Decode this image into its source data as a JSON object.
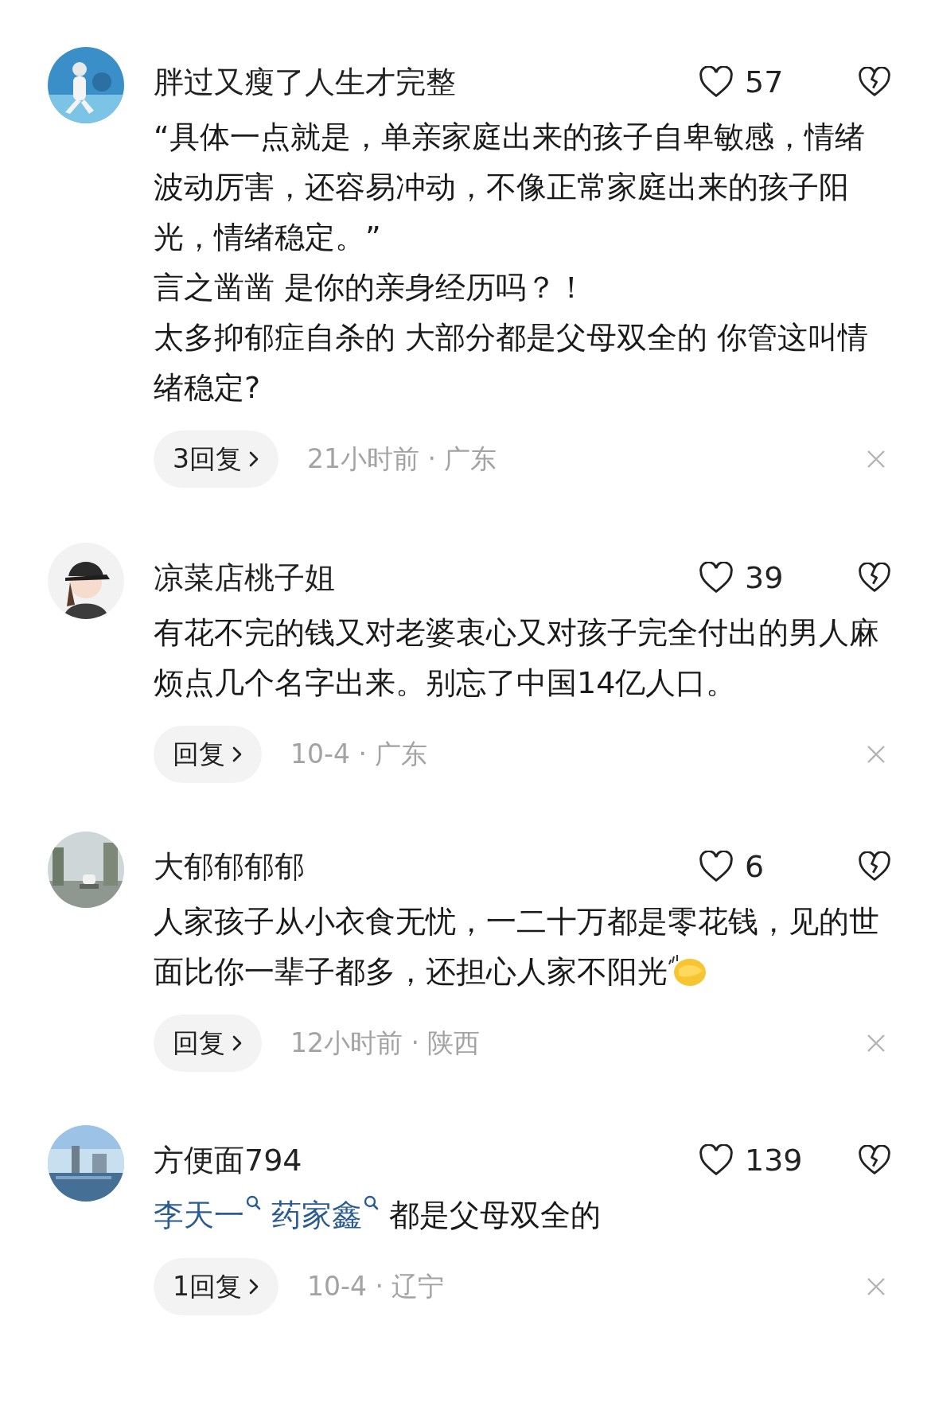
{
  "comments": [
    {
      "avatar": {
        "kind": "picture"
      },
      "name": "胖过又瘦了人生才完整",
      "likes": "57",
      "body": [
        [
          {
            "kind": "text",
            "text": "“具体一点就是，单亲家庭出来的孩子自卑敏感，情绪波动厉害，还容易冲动，不像正常家庭出来的孩子阳光，情绪稳定。”"
          }
        ],
        [
          {
            "kind": "text",
            "text": "言之凿凿 是你的亲身经历吗？！"
          }
        ],
        [
          {
            "kind": "text",
            "text": "太多抑郁症自杀的 大部分都是父母双全的 你管这叫情绪稳定?"
          }
        ]
      ],
      "replies": "3回复",
      "time": "21小时前 · 广东"
    },
    {
      "avatar": {
        "kind": "picture"
      },
      "name": "凉菜店桃子姐",
      "likes": "39",
      "body": [
        [
          {
            "kind": "text",
            "text": "有花不完的钱又对老婆衷心又对孩子完全付出的男人麻烦点几个名字出来。别忘了中国14亿人口。"
          }
        ]
      ],
      "replies": "回复",
      "time": "10-4 · 广东"
    },
    {
      "avatar": {
        "kind": "picture"
      },
      "name": "大郁郁郁郁",
      "likes": "6",
      "body": [
        [
          {
            "kind": "text",
            "text": "人家孩子从小衣食无忧，一二十万都是零花钱，见的世面比你一辈子都多，还担心人家不阳光"
          },
          {
            "kind": "emoji"
          }
        ]
      ],
      "replies": "回复",
      "time": "12小时前 · 陕西"
    },
    {
      "avatar": {
        "kind": "picture"
      },
      "name": "方便面794",
      "likes": "139",
      "body": [
        [
          {
            "kind": "link",
            "text": "李天一"
          },
          {
            "kind": "link",
            "text": "药家鑫"
          },
          {
            "kind": "text",
            "text": "都是父母双全的"
          }
        ]
      ],
      "replies": "1回复",
      "time": "10-4 · 辽宁"
    }
  ]
}
